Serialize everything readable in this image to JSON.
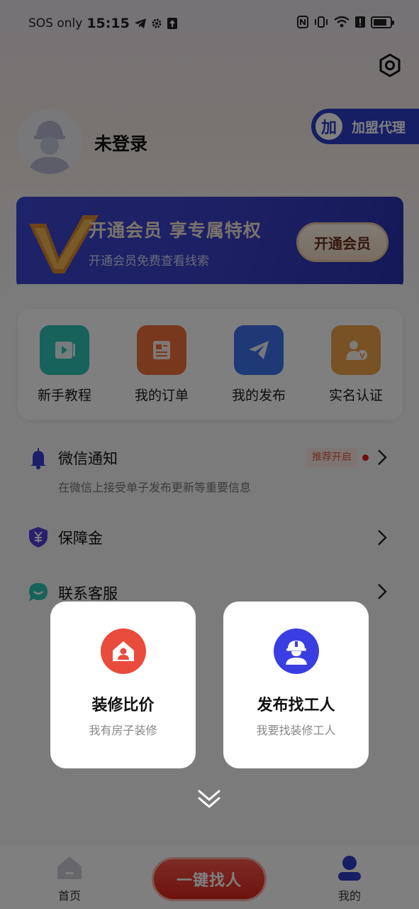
{
  "status_bar": {
    "carrier": "SOS only",
    "time": "15:15"
  },
  "profile": {
    "name": "未登录",
    "join_agent_badge": "加",
    "join_agent_label": "加盟代理"
  },
  "vip_banner": {
    "title": "开通会员 享专属特权",
    "subtitle": "开通会员免费查看线索",
    "button": "开通会员"
  },
  "quick_actions": [
    {
      "label": "新手教程",
      "color": "#2fc5b4"
    },
    {
      "label": "我的订单",
      "color": "#f0703a"
    },
    {
      "label": "我的发布",
      "color": "#3d73ec"
    },
    {
      "label": "实名认证",
      "color": "#f0a24a"
    }
  ],
  "menu": {
    "wechat": {
      "title": "微信通知",
      "desc": "在微信上接受单子发布更新等重要信息",
      "badge": "推荐开启"
    },
    "deposit": {
      "title": "保障金"
    },
    "service": {
      "title": "联系客服"
    }
  },
  "popup": {
    "cards": [
      {
        "title": "装修比价",
        "subtitle": "我有房子装修",
        "color": "#f04a3c"
      },
      {
        "title": "发布找工人",
        "subtitle": "我要找装修工人",
        "color": "#3a3ee2"
      }
    ]
  },
  "tabbar": {
    "home": "首页",
    "center": "一键找人",
    "mine": "我的"
  },
  "colors": {
    "brand_blue": "#2c3cc8",
    "brand_red": "#e2311f"
  }
}
